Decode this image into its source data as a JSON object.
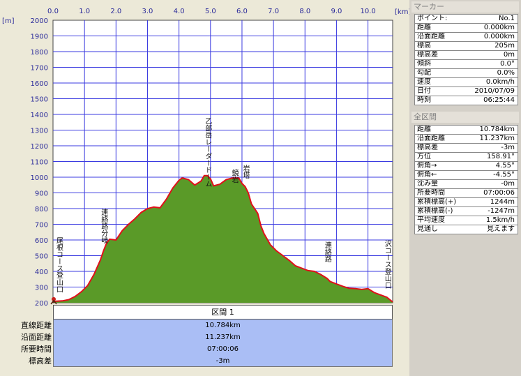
{
  "chart_data": {
    "type": "area",
    "x_unit": "[km]",
    "y_unit": "[m]",
    "x_ticks": [
      "0.0",
      "1.0",
      "2.0",
      "3.0",
      "4.0",
      "5.0",
      "6.0",
      "7.0",
      "8.0",
      "9.0",
      "10.0"
    ],
    "y_ticks": [
      "200",
      "300",
      "400",
      "500",
      "600",
      "700",
      "800",
      "900",
      "1000",
      "1100",
      "1200",
      "1300",
      "1400",
      "1500",
      "1600",
      "1700",
      "1800",
      "1900",
      "2000"
    ],
    "xlim": [
      0,
      10.784
    ],
    "ylim": [
      200,
      2000
    ],
    "grid": true,
    "line_color": "#e0101a",
    "fill_color": "#5a9a28",
    "x": [
      0,
      0.1,
      0.3,
      0.5,
      0.7,
      0.9,
      1.1,
      1.3,
      1.5,
      1.6,
      1.7,
      1.8,
      2.0,
      2.2,
      2.4,
      2.6,
      2.8,
      3.0,
      3.2,
      3.4,
      3.6,
      3.8,
      4.0,
      4.1,
      4.3,
      4.5,
      4.7,
      4.8,
      4.9,
      5.0,
      5.1,
      5.3,
      5.5,
      5.7,
      5.9,
      6.0,
      6.1,
      6.2,
      6.3,
      6.5,
      6.6,
      6.7,
      6.9,
      7.1,
      7.3,
      7.5,
      7.7,
      7.9,
      8.1,
      8.3,
      8.5,
      8.7,
      8.8,
      9.0,
      9.2,
      9.4,
      9.6,
      9.8,
      10.0,
      10.2,
      10.4,
      10.6,
      10.784
    ],
    "y": [
      205,
      210,
      212,
      220,
      240,
      270,
      310,
      380,
      470,
      530,
      580,
      605,
      600,
      660,
      700,
      735,
      775,
      800,
      810,
      805,
      860,
      930,
      980,
      995,
      985,
      950,
      975,
      1010,
      1010,
      990,
      945,
      955,
      985,
      995,
      995,
      960,
      940,
      900,
      830,
      770,
      690,
      640,
      570,
      530,
      500,
      470,
      435,
      420,
      405,
      400,
      380,
      355,
      335,
      320,
      305,
      292,
      290,
      285,
      290,
      265,
      250,
      235,
      205
    ],
    "annotations": [
      {
        "label": "尾根コース登山口",
        "x": 0.05,
        "y_top": 620
      },
      {
        "label": "連絡路分岐",
        "x": 1.6,
        "y_top": 800
      },
      {
        "label": "乙部岳レーダードーム",
        "x": 4.9,
        "y_top": 1380
      },
      {
        "label": "鏡岩",
        "x": 5.75,
        "y_top": 1050
      },
      {
        "label": "岩塔",
        "x": 6.1,
        "y_top": 1080
      },
      {
        "label": "連絡路",
        "x": 8.7,
        "y_top": 590
      },
      {
        "label": "沢コース登山口",
        "x": 10.6,
        "y_top": 600
      }
    ],
    "marker": {
      "x": 0,
      "y": 205
    }
  },
  "section": {
    "tab_label": "区間 1",
    "rows": [
      {
        "label": "直線距離",
        "value": "10.784km"
      },
      {
        "label": "沿面距離",
        "value": "11.237km"
      },
      {
        "label": "所要時間",
        "value": "07:00:06"
      },
      {
        "label": "標高差",
        "value": "-3m"
      }
    ]
  },
  "marker_panel": {
    "title": "マーカー",
    "rows": [
      {
        "k": "ポイント:",
        "v": "No.1"
      },
      {
        "k": "距離",
        "v": "0.000km"
      },
      {
        "k": "沿面距離",
        "v": "0.000km"
      },
      {
        "k": "標高",
        "v": "205m"
      },
      {
        "k": "標高差",
        "v": "0m"
      },
      {
        "k": "傾斜",
        "v": "0.0°"
      },
      {
        "k": "勾配",
        "v": "0.0%"
      },
      {
        "k": "速度",
        "v": "0.0km/h"
      },
      {
        "k": "日付",
        "v": "2010/07/09"
      },
      {
        "k": "時刻",
        "v": "06:25:44"
      }
    ]
  },
  "total_panel": {
    "title": "全区間",
    "rows": [
      {
        "k": "距離",
        "v": "10.784km"
      },
      {
        "k": "沿面距離",
        "v": "11.237km"
      },
      {
        "k": "標高差",
        "v": "-3m"
      },
      {
        "k": "方位",
        "v": "158.91°"
      },
      {
        "k": "俯角→",
        "v": "4.55°"
      },
      {
        "k": "俯角←",
        "v": "-4.55°"
      },
      {
        "k": "沈み量",
        "v": "-0m"
      },
      {
        "k": "所要時間",
        "v": "07:00:06"
      },
      {
        "k": "累積標高(+)",
        "v": "1244m"
      },
      {
        "k": "累積標高(-)",
        "v": "-1247m"
      },
      {
        "k": "平均速度",
        "v": "1.5km/h"
      },
      {
        "k": "見通し",
        "v": "見えます"
      }
    ]
  }
}
